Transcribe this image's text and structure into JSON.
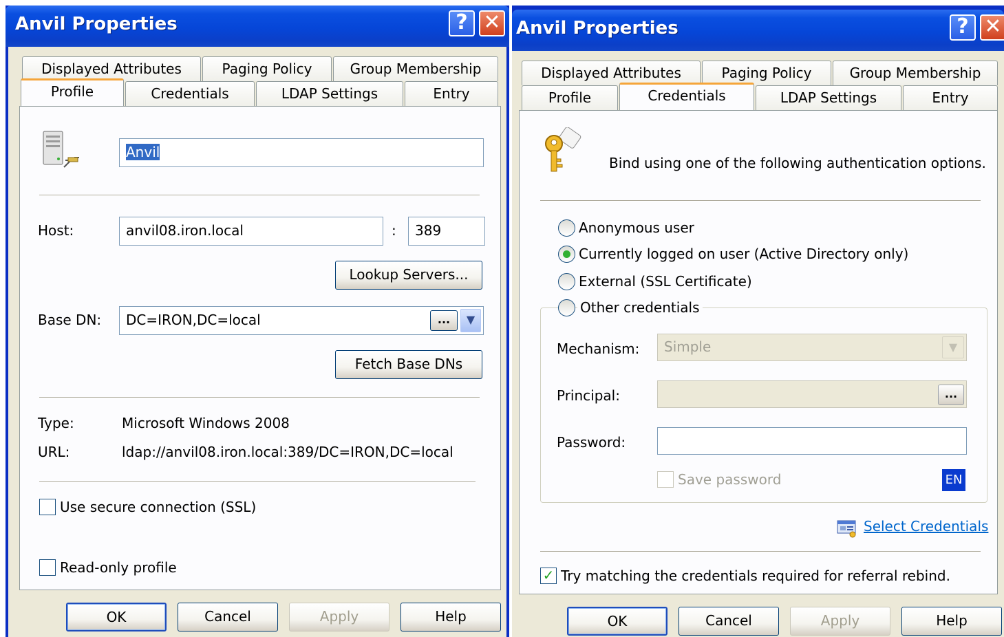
{
  "colors": {
    "title_bar": "#0646d8",
    "selected_tab_accent": "#f5a53a",
    "link": "#0066cc",
    "dialog_bg": "#ece9d8"
  },
  "left_dialog": {
    "title": "Anvil Properties",
    "help_btn": "?",
    "close_btn": "✕",
    "tabs_row1": [
      "Displayed Attributes",
      "Paging Policy",
      "Group Membership"
    ],
    "tabs_row2": [
      "Profile",
      "Credentials",
      "LDAP Settings",
      "Entry"
    ],
    "active_tab": "Profile",
    "profile_icon": "server-icon",
    "profile_name": "Anvil",
    "host_label": "Host:",
    "host_value": "anvil08.iron.local",
    "port_separator": ":",
    "port_value": "389",
    "lookup_servers_btn": "Lookup Servers...",
    "base_dn_label": "Base DN:",
    "base_dn_value": "DC=IRON,DC=local",
    "base_dn_browse": "...",
    "fetch_base_dns_btn": "Fetch Base DNs",
    "type_label": "Type:",
    "type_value": "Microsoft Windows 2008",
    "url_label": "URL:",
    "url_value": "ldap://anvil08.iron.local:389/DC=IRON,DC=local",
    "ssl_label": "Use secure connection (SSL)",
    "ssl_checked": false,
    "readonly_label": "Read-only profile",
    "readonly_checked": false,
    "buttons": {
      "ok": "OK",
      "cancel": "Cancel",
      "apply": "Apply",
      "help": "Help"
    }
  },
  "right_dialog": {
    "title": "Anvil Properties",
    "help_btn": "?",
    "close_btn": "✕",
    "tabs_row1": [
      "Displayed Attributes",
      "Paging Policy",
      "Group Membership"
    ],
    "tabs_row2": [
      "Profile",
      "Credentials",
      "LDAP Settings",
      "Entry"
    ],
    "active_tab": "Credentials",
    "keys_icon": "keys-icon",
    "intro": "Bind using one of the following authentication options.",
    "options": [
      "Anonymous user",
      "Currently logged on user (Active Directory only)",
      "External (SSL Certificate)",
      "Other credentials"
    ],
    "selected_option": "Currently logged on user (Active Directory only)",
    "mechanism_label": "Mechanism:",
    "mechanism_value": "Simple",
    "principal_label": "Principal:",
    "principal_value": "",
    "principal_browse": "...",
    "password_label": "Password:",
    "password_value": "",
    "save_password_label": "Save password",
    "save_password_checked": false,
    "language_badge": "EN",
    "select_credentials_link": "Select Credentials",
    "referral_label": "Try matching the credentials required for referral rebind.",
    "referral_checked": true,
    "buttons": {
      "ok": "OK",
      "cancel": "Cancel",
      "apply": "Apply",
      "help": "Help"
    }
  }
}
